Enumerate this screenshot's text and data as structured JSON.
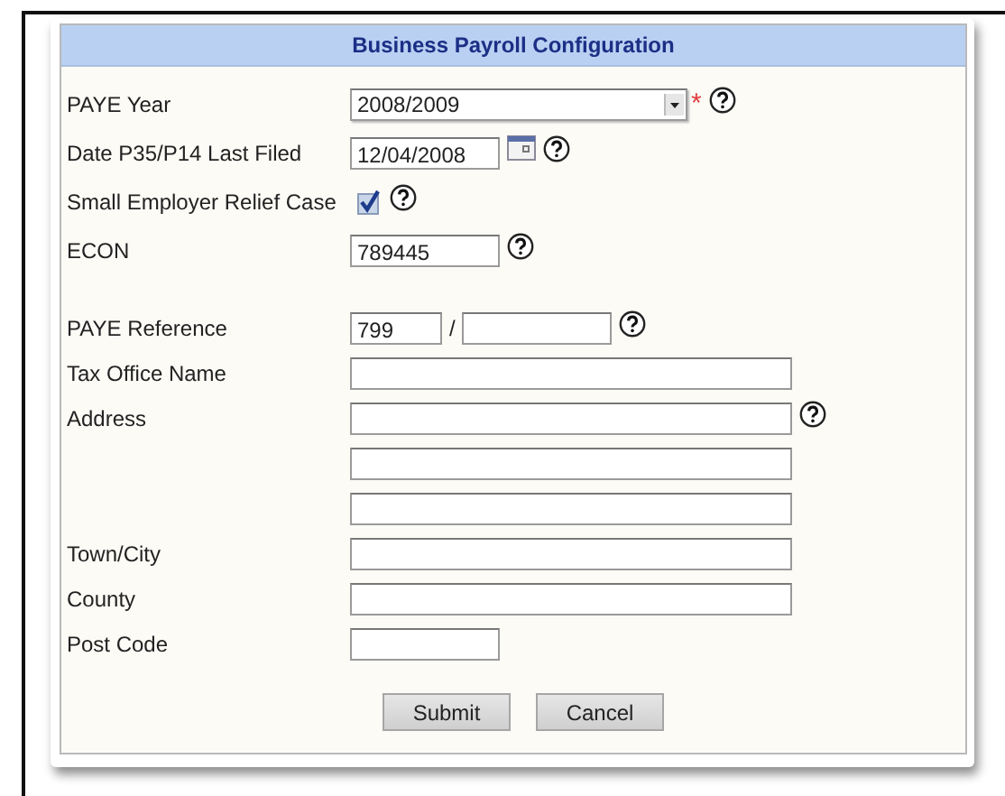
{
  "panel": {
    "title": "Business Payroll Configuration"
  },
  "sections": [
    [
      {
        "kind": "select",
        "label": "PAYE Year",
        "value": "2008/2009",
        "required_mark": "*",
        "help": true
      },
      {
        "kind": "date",
        "label": "Date P35/P14 Last Filed",
        "value": "12/04/2008",
        "help": true
      },
      {
        "kind": "checkbox",
        "label": "Small Employer Relief Case",
        "checked": true,
        "help": true
      },
      {
        "kind": "short_text",
        "label": "ECON",
        "value": "789445",
        "help": true
      }
    ],
    [
      {
        "kind": "reference",
        "label": "PAYE Reference",
        "value": "799",
        "separator": "/",
        "help": true
      },
      {
        "kind": "long_text",
        "label": "Tax Office Name",
        "help": false
      },
      {
        "kind": "long_text",
        "label": "Address",
        "help": true
      },
      {
        "kind": "long_text",
        "help": false
      },
      {
        "kind": "long_text",
        "help": false
      },
      {
        "kind": "long_text",
        "label": "Town/City",
        "help": false
      },
      {
        "kind": "long_text",
        "label": "County",
        "help": false
      },
      {
        "kind": "short_text",
        "label": "Post Code",
        "help": false
      }
    ]
  ],
  "buttons": [
    "Submit",
    "Cancel"
  ]
}
